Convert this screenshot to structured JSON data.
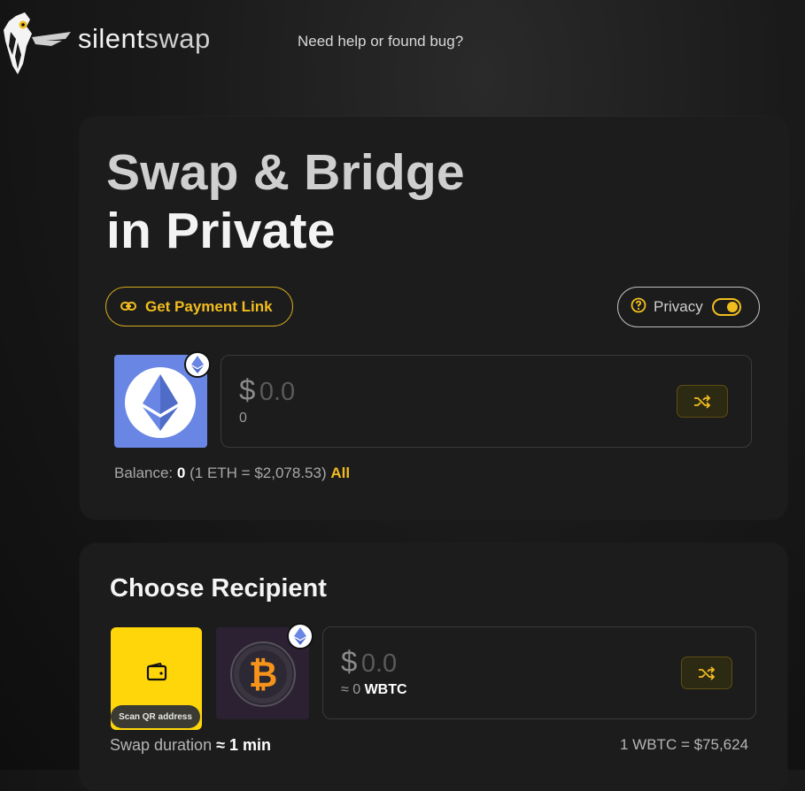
{
  "header": {
    "brand_part1": "silent",
    "brand_part2": "swap",
    "help_link": "Need help or found bug?"
  },
  "hero": {
    "line1": "Swap & Bridge",
    "line2": "in Private"
  },
  "actions": {
    "payment_link": "Get Payment Link",
    "privacy_label": "Privacy",
    "privacy_enabled": true
  },
  "source": {
    "token_icon": "ethereum-icon",
    "chain_icon": "ethereum-chain-icon",
    "currency_symbol": "$",
    "amount_placeholder": "0.0",
    "token_amount": "0",
    "balance_label": "Balance:",
    "balance_value": "0",
    "rate_text": "(1 ETH = $2,078.53)",
    "all_label": "All"
  },
  "recipient": {
    "title": "Choose Recipient",
    "scan_label": "Scan QR address",
    "token_icon": "bitcoin-icon",
    "chain_icon": "ethereum-chain-icon",
    "currency_symbol": "$",
    "amount_placeholder": "0.0",
    "approx_prefix": "≈ 0",
    "token_symbol": "WBTC",
    "duration_label": "Swap duration",
    "duration_value": "≈ 1 min",
    "rate_text": "1 WBTC = $75,624"
  },
  "colors": {
    "accent": "#f1bd1e",
    "eth_tile": "#6a86e4",
    "scan_tile": "#ffd60a",
    "btc_orange": "#f7931a"
  }
}
